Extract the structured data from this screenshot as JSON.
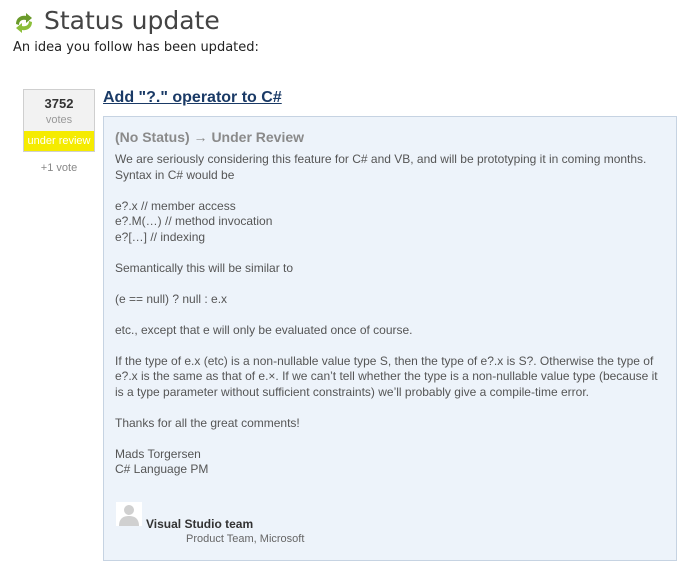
{
  "header": {
    "title": "Status update",
    "subtitle": "An idea you follow has been updated:",
    "icon": "refresh-icon",
    "icon_color": "#6a9a2a"
  },
  "votes": {
    "count": "3752",
    "label": "votes",
    "status_badge": "under review",
    "status_color": "#f5eb00",
    "plus_vote": "+1 vote"
  },
  "idea": {
    "title": "Add \"?.\" operator to C#"
  },
  "update": {
    "status_change": "(No Status) → Under Review",
    "paragraphs": [
      [
        "We are seriously considering this feature for C# and VB, and will be prototyping it in coming months.",
        "Syntax in C# would be"
      ],
      [
        "e?.x // member access",
        "e?.M(…) // method invocation",
        "e?[…] // indexing"
      ],
      [
        "Semantically this will be similar to"
      ],
      [
        "(e == null) ? null : e.x"
      ],
      [
        "etc., except that e will only be evaluated once of course."
      ],
      [
        "If the type of e.x (etc) is a non-nullable value type S, then the type of e?.x is S?. Otherwise the type of",
        "e?.x is the same as that of e.×. If we can’t tell whether the type is a non-nullable value type (because it",
        "is a type parameter without sufficient constraints) we’ll probably give a compile-time error."
      ],
      [
        "Thanks for all the great comments!"
      ],
      [
        "Mads Torgersen",
        "C# Language PM"
      ]
    ]
  },
  "author": {
    "name": "Visual Studio team",
    "role": "Product Team, Microsoft",
    "avatar_icon": "user-avatar-icon"
  }
}
